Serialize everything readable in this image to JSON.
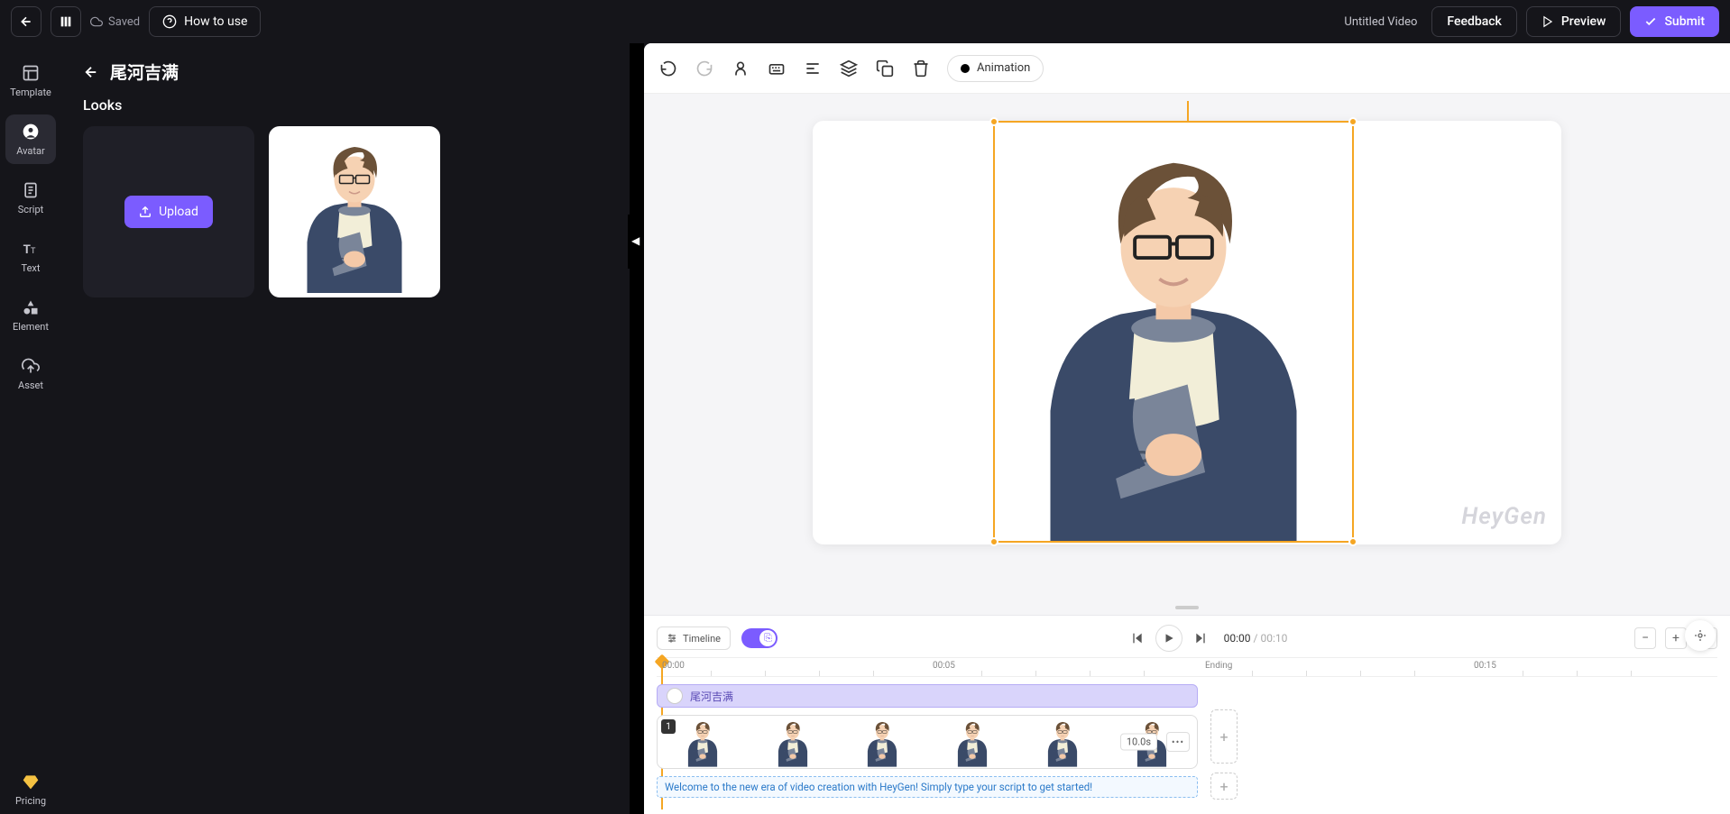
{
  "topbar": {
    "saved_label": "Saved",
    "howto_label": "How to use",
    "project_name": "Untitled Video",
    "feedback_label": "Feedback",
    "preview_label": "Preview",
    "submit_label": "Submit"
  },
  "rail": {
    "template": "Template",
    "avatar": "Avatar",
    "script": "Script",
    "text": "Text",
    "element": "Element",
    "asset": "Asset",
    "pricing": "Pricing"
  },
  "panel": {
    "title": "尾河吉满",
    "subhead": "Looks",
    "upload_label": "Upload"
  },
  "toolbar": {
    "animation_label": "Animation"
  },
  "canvas": {
    "watermark": "HeyGen"
  },
  "timeline": {
    "timeline_btn": "Timeline",
    "current": "00:00",
    "sep": " / ",
    "total": "00:10",
    "ruler": {
      "t0": "00:00",
      "t1": "00:05",
      "t2": "00:15",
      "ending": "Ending"
    },
    "voice_track_name": "尾河吉满",
    "clip_index": "1",
    "clip_duration": "10.0s",
    "script_text": "Welcome to the new era of video creation with HeyGen! Simply type your script to get started!"
  }
}
